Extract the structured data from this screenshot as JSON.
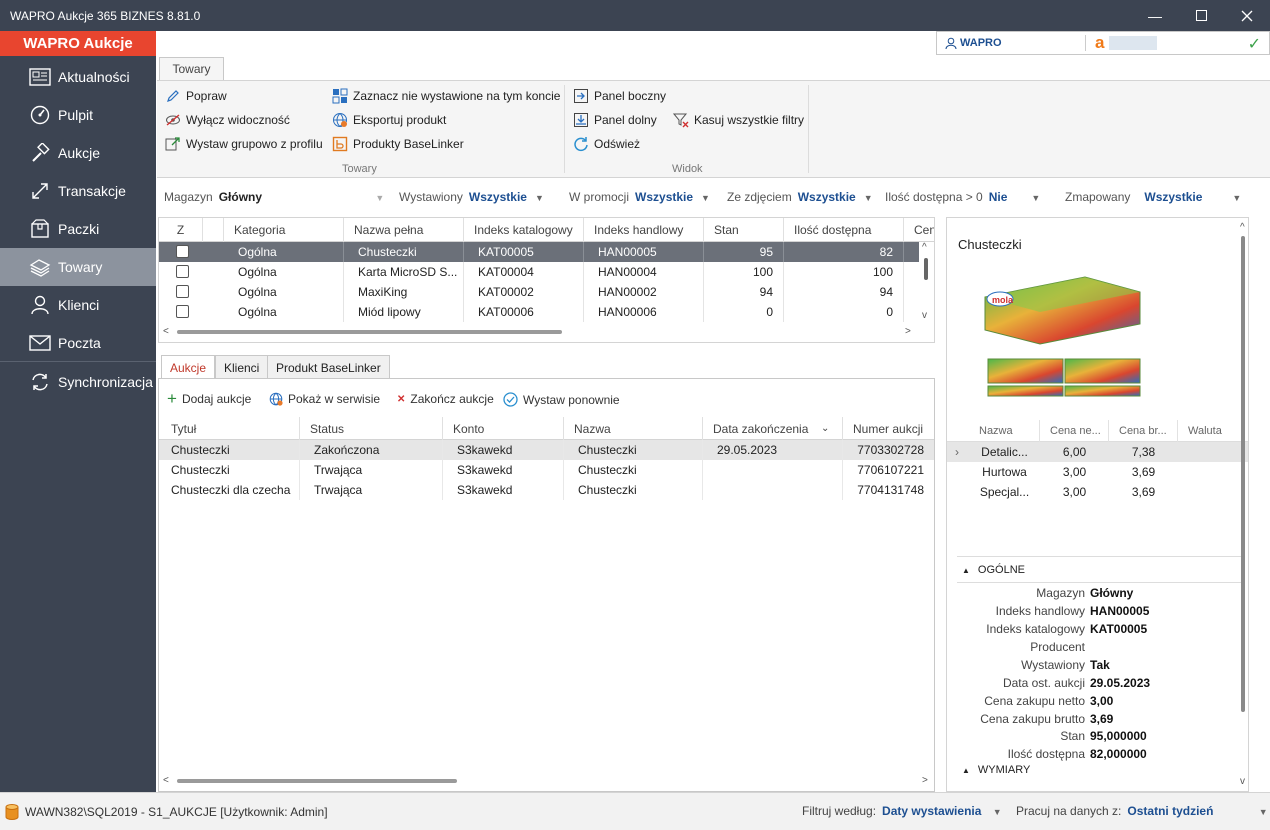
{
  "window": {
    "title": "WAPRO Aukcje 365 BIZNES 8.81.0"
  },
  "sidebar": {
    "brand": "WAPRO Aukcje",
    "items": [
      {
        "label": "Aktualności",
        "icon": "news-icon"
      },
      {
        "label": "Pulpit",
        "icon": "dashboard-icon"
      },
      {
        "label": "Aukcje",
        "icon": "gavel-icon"
      },
      {
        "label": "Transakcje",
        "icon": "transactions-icon"
      },
      {
        "label": "Paczki",
        "icon": "package-icon"
      },
      {
        "label": "Towary",
        "icon": "products-icon",
        "active": true
      },
      {
        "label": "Klienci",
        "icon": "user-icon"
      },
      {
        "label": "Poczta",
        "icon": "mail-icon"
      },
      {
        "label": "Synchronizacja",
        "icon": "sync-icon"
      }
    ]
  },
  "account": {
    "user": "WAPRO",
    "status": "✓"
  },
  "ribbon": {
    "tab": "Towary",
    "buttons": {
      "popraw": "Popraw",
      "wylacz": "Wyłącz widoczność",
      "wystaw_grupowo": "Wystaw grupowo z profilu",
      "zaznacz": "Zaznacz nie wystawione na tym koncie",
      "eksportuj": "Eksportuj produkt",
      "baselinker": "Produkty BaseLinker",
      "panel_boczny": "Panel boczny",
      "panel_dolny": "Panel dolny",
      "kasuj": "Kasuj wszystkie filtry",
      "odswiez": "Odśwież"
    },
    "groups": {
      "towary": "Towary",
      "widok": "Widok"
    }
  },
  "filters": {
    "magazyn_label": "Magazyn",
    "magazyn_value": "Główny",
    "wystawiony_label": "Wystawiony",
    "wystawiony_value": "Wszystkie",
    "promocja_label": "W promocji",
    "promocja_value": "Wszystkie",
    "zdjecie_label": "Ze zdjęciem",
    "zdjecie_value": "Wszystkie",
    "ilosc_label": "Ilość dostępna > 0",
    "ilosc_value": "Nie",
    "zmapowany_label": "Zmapowany",
    "zmapowany_value": "Wszystkie"
  },
  "products": {
    "columns": [
      "Z",
      "Kategoria",
      "Nazwa pełna",
      "Indeks katalogowy",
      "Indeks handlowy",
      "Stan",
      "Ilość dostępna",
      "Cen"
    ],
    "rows": [
      {
        "kategoria": "Ogólna",
        "nazwa": "Chusteczki",
        "kat": "KAT00005",
        "han": "HAN00005",
        "stan": "95",
        "ilosc": "82"
      },
      {
        "kategoria": "Ogólna",
        "nazwa": "Karta MicroSD S...",
        "kat": "KAT00004",
        "han": "HAN00004",
        "stan": "100",
        "ilosc": "100"
      },
      {
        "kategoria": "Ogólna",
        "nazwa": "MaxiKing",
        "kat": "KAT00002",
        "han": "HAN00002",
        "stan": "94",
        "ilosc": "94"
      },
      {
        "kategoria": "Ogólna",
        "nazwa": "Miód lipowy",
        "kat": "KAT00006",
        "han": "HAN00006",
        "stan": "0",
        "ilosc": "0"
      }
    ]
  },
  "bottom_tabs": [
    "Aukcje",
    "Klienci",
    "Produkt BaseLinker"
  ],
  "auction_toolbar": {
    "dodaj": "Dodaj aukcje",
    "pokaz": "Pokaż w serwisie",
    "zakoncz": "Zakończ aukcje",
    "wystaw": "Wystaw ponownie"
  },
  "auctions": {
    "columns": [
      "Tytuł",
      "Status",
      "Konto",
      "Nazwa",
      "Data zakończenia",
      "Numer aukcji"
    ],
    "rows": [
      {
        "tytul": "Chusteczki",
        "status": "Zakończona",
        "konto": "S3kawekd",
        "nazwa": "Chusteczki",
        "data": "29.05.2023",
        "numer": "7703302728"
      },
      {
        "tytul": "Chusteczki",
        "status": "Trwająca",
        "konto": "S3kawekd",
        "nazwa": "Chusteczki",
        "data": "",
        "numer": "7706107221"
      },
      {
        "tytul": "Chusteczki dla czecha",
        "status": "Trwająca",
        "konto": "S3kawekd",
        "nazwa": "Chusteczki",
        "data": "",
        "numer": "7704131748"
      }
    ]
  },
  "details": {
    "title": "Chusteczki",
    "image_brand": "mola",
    "price_columns": [
      "Nazwa",
      "Cena ne...",
      "Cena br...",
      "Waluta"
    ],
    "prices": [
      {
        "nazwa": "Detalic...",
        "netto": "6,00",
        "brutto": "7,38"
      },
      {
        "nazwa": "Hurtowa",
        "netto": "3,00",
        "brutto": "3,69"
      },
      {
        "nazwa": "Specjal...",
        "netto": "3,00",
        "brutto": "3,69"
      }
    ],
    "section_general": "OGÓLNE",
    "section_dimensions": "WYMIARY",
    "props": [
      {
        "k": "Magazyn",
        "v": "Główny"
      },
      {
        "k": "Indeks handlowy",
        "v": "HAN00005"
      },
      {
        "k": "Indeks katalogowy",
        "v": "KAT00005"
      },
      {
        "k": "Producent",
        "v": ""
      },
      {
        "k": "Wystawiony",
        "v": "Tak"
      },
      {
        "k": "Data ost. aukcji",
        "v": "29.05.2023"
      },
      {
        "k": "Cena zakupu netto",
        "v": "3,00"
      },
      {
        "k": "Cena zakupu brutto",
        "v": "3,69"
      },
      {
        "k": "Stan",
        "v": "95,000000"
      },
      {
        "k": "Ilość dostępna",
        "v": "82,000000"
      }
    ]
  },
  "statusbar": {
    "db": "WAWN382\\SQL2019 - S1_AUKCJE [Użytkownik: Admin]",
    "filter_label": "Filtruj według:",
    "filter_value": "Daty wystawienia",
    "work_label": "Pracuj na danych z:",
    "work_value": "Ostatni tydzień"
  },
  "colors": {
    "sidebar": "#3c4452",
    "brand": "#e8452f",
    "accent": "#1d4f91",
    "selected_row": "#6b7079"
  }
}
